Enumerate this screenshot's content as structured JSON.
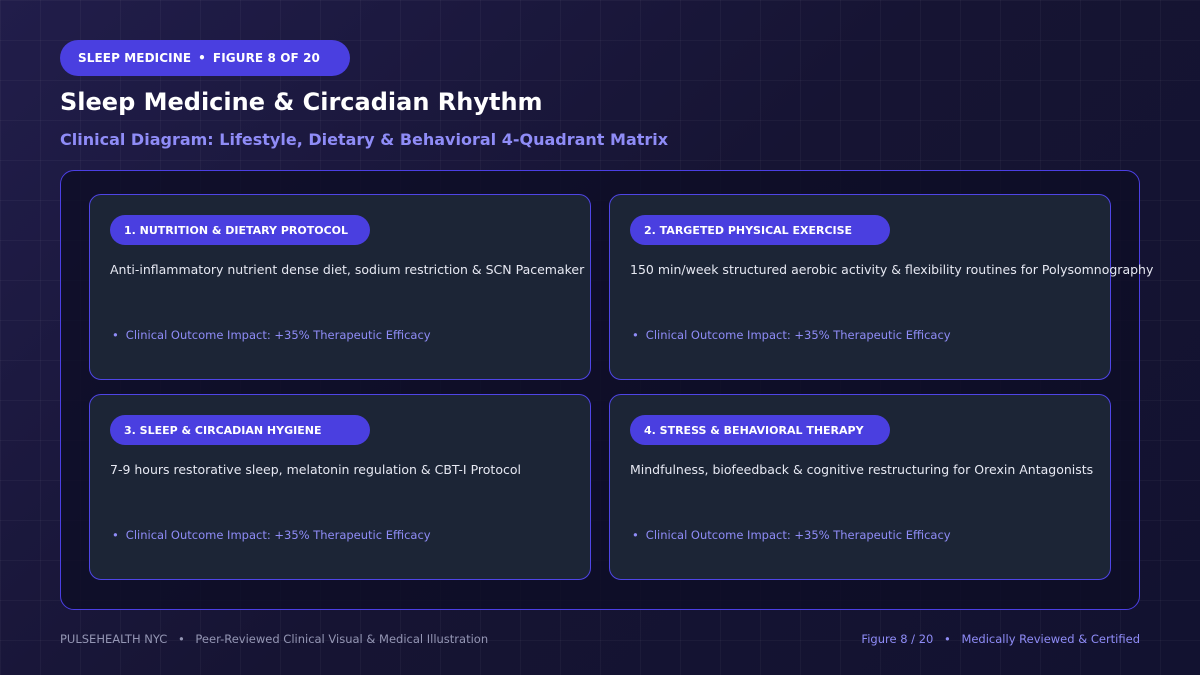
{
  "header": {
    "category": "SLEEP MEDICINE",
    "separator": "•",
    "figure_label": "FIGURE 8 OF 20",
    "title": "Sleep Medicine & Circadian Rhythm",
    "subtitle": "Clinical Diagram: Lifestyle, Dietary & Behavioral 4-Quadrant Matrix"
  },
  "quadrants": [
    {
      "label": "1. NUTRITION & DIETARY PROTOCOL",
      "description": "Anti-inflammatory nutrient dense diet, sodium restriction & SCN Pacemaker",
      "bullet": "•",
      "impact": "Clinical Outcome Impact: +35% Therapeutic Efficacy"
    },
    {
      "label": "2. TARGETED PHYSICAL EXERCISE",
      "description": "150 min/week structured aerobic activity & flexibility routines for Polysomnography",
      "bullet": "•",
      "impact": "Clinical Outcome Impact: +35% Therapeutic Efficacy"
    },
    {
      "label": "3. SLEEP & CIRCADIAN HYGIENE",
      "description": "7-9 hours restorative sleep, melatonin regulation & CBT-I Protocol",
      "bullet": "•",
      "impact": "Clinical Outcome Impact: +35% Therapeutic Efficacy"
    },
    {
      "label": "4. STRESS & BEHAVIORAL THERAPY",
      "description": "Mindfulness, biofeedback & cognitive restructuring for Orexin Antagonists",
      "bullet": "•",
      "impact": "Clinical Outcome Impact: +35% Therapeutic Efficacy"
    }
  ],
  "footer": {
    "brand": "PULSEHEALTH NYC",
    "separator": "•",
    "left_text": "Peer-Reviewed Clinical Visual & Medical Illustration",
    "figure_counter": "Figure 8 / 20",
    "right_text": "Medically Reviewed & Certified"
  },
  "colors": {
    "accent": "#4a3fe0",
    "accent_text": "#8f8cf7",
    "background": "#141331",
    "card": "#1c2536"
  }
}
